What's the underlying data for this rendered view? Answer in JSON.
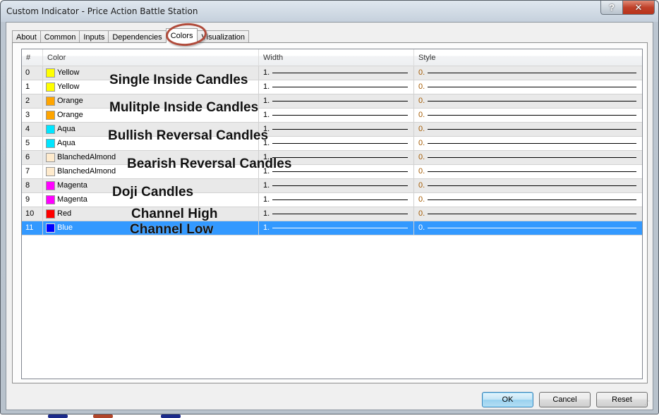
{
  "window": {
    "title": "Custom Indicator - Price Action Battle Station",
    "help_icon": "?",
    "close_icon": "✕"
  },
  "tabs": [
    {
      "label": "About",
      "active": false
    },
    {
      "label": "Common",
      "active": false
    },
    {
      "label": "Inputs",
      "active": false
    },
    {
      "label": "Dependencies",
      "active": false
    },
    {
      "label": "Colors",
      "active": true
    },
    {
      "label": "Visualization",
      "active": false
    }
  ],
  "grid": {
    "headers": {
      "index": "#",
      "color": "Color",
      "width": "Width",
      "style": "Style"
    },
    "rows": [
      {
        "index": "0",
        "color_name": "Yellow",
        "swatch": "#ffff00",
        "width": "1.",
        "style": "0.",
        "selected": false
      },
      {
        "index": "1",
        "color_name": "Yellow",
        "swatch": "#ffff00",
        "width": "1.",
        "style": "0.",
        "selected": false
      },
      {
        "index": "2",
        "color_name": "Orange",
        "swatch": "#ffa500",
        "width": "1.",
        "style": "0.",
        "selected": false
      },
      {
        "index": "3",
        "color_name": "Orange",
        "swatch": "#ffa500",
        "width": "1.",
        "style": "0.",
        "selected": false
      },
      {
        "index": "4",
        "color_name": "Aqua",
        "swatch": "#00e5ff",
        "width": "1.",
        "style": "0.",
        "selected": false
      },
      {
        "index": "5",
        "color_name": "Aqua",
        "swatch": "#00e5ff",
        "width": "1.",
        "style": "0.",
        "selected": false
      },
      {
        "index": "6",
        "color_name": "BlanchedAlmond",
        "swatch": "#ffebcd",
        "width": "1.",
        "style": "0.",
        "selected": false
      },
      {
        "index": "7",
        "color_name": "BlanchedAlmond",
        "swatch": "#ffebcd",
        "width": "1.",
        "style": "0.",
        "selected": false
      },
      {
        "index": "8",
        "color_name": "Magenta",
        "swatch": "#ff00ff",
        "width": "1.",
        "style": "0.",
        "selected": false
      },
      {
        "index": "9",
        "color_name": "Magenta",
        "swatch": "#ff00ff",
        "width": "1.",
        "style": "0.",
        "selected": false
      },
      {
        "index": "10",
        "color_name": "Red",
        "swatch": "#ff0000",
        "width": "1.",
        "style": "0.",
        "selected": false
      },
      {
        "index": "11",
        "color_name": "Blue",
        "swatch": "#0000ff",
        "width": "1.",
        "style": "0.",
        "selected": true
      }
    ]
  },
  "annotations": [
    "Single Inside Candles",
    "Mulitple Inside Candles",
    "Bullish Reversal Candles",
    "Bearish Reversal Candles",
    "Doji Candles",
    "Channel High",
    "Channel Low"
  ],
  "buttons": {
    "ok": "OK",
    "cancel": "Cancel",
    "reset": "Reset"
  },
  "colors": {
    "selection": "#3399ff",
    "annotation_circle": "#b04a3a"
  }
}
